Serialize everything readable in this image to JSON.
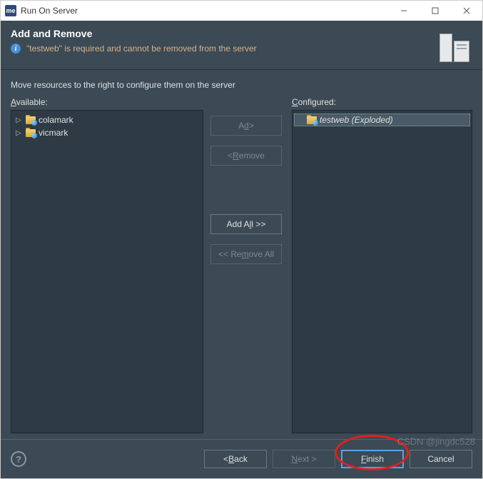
{
  "window": {
    "title": "Run On Server",
    "app_icon_text": "me"
  },
  "banner": {
    "title": "Add and Remove",
    "message": "\"testweb\" is required and cannot be removed from the server"
  },
  "body": {
    "description": "Move resources to the right to configure them on the server",
    "available_label_accel": "A",
    "available_label_rest": "vailable:",
    "configured_label_accel": "C",
    "configured_label_rest": "onfigured:",
    "available_items": [
      {
        "label": "colamark"
      },
      {
        "label": "vicmark"
      }
    ],
    "configured_items": [
      {
        "label": "testweb",
        "suffix": "(Exploded)"
      }
    ],
    "buttons": {
      "add_accel": "d",
      "add_pre": "A",
      "add_post": "d >",
      "remove_pre": "< ",
      "remove_accel": "R",
      "remove_post": "emove",
      "addall_pre": "Add A",
      "addall_accel": "l",
      "addall_post": "l >>",
      "removeall_pre": "<< Re",
      "removeall_accel": "m",
      "removeall_post": "ove All"
    }
  },
  "footer": {
    "back_pre": "< ",
    "back_accel": "B",
    "back_post": "ack",
    "next_accel": "N",
    "next_post": "ext >",
    "finish_accel": "F",
    "finish_post": "inish",
    "cancel": "Cancel"
  },
  "watermark": "CSDN @jingdc528"
}
